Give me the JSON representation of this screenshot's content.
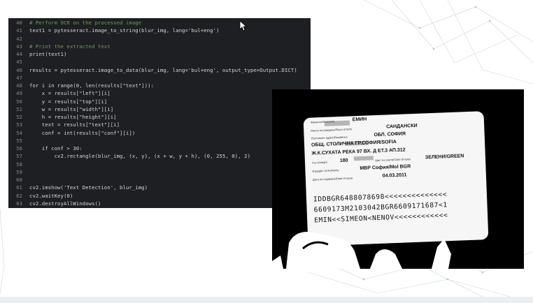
{
  "editor": {
    "lines": [
      {
        "num": "40",
        "code": "# Perform OCR on the processed image",
        "color": "#6a9955"
      },
      {
        "num": "41",
        "code": "text1 = pytesseract.image_to_string(blur_img, lang='bul+eng')",
        "color": "#d4d4d4"
      },
      {
        "num": "42",
        "code": "",
        "color": "#d4d4d4"
      },
      {
        "num": "43",
        "code": "# Print the extracted text",
        "color": "#6a9955"
      },
      {
        "num": "44",
        "code": "print(text1)",
        "color": "#d4d4d4"
      },
      {
        "num": "45",
        "code": "",
        "color": "#d4d4d4"
      },
      {
        "num": "46",
        "code": "results = pytesseract.image_to_data(blur_img, lang='bul+eng', output_type=Output.DICT)",
        "color": "#d4d4d4"
      },
      {
        "num": "47",
        "code": "",
        "color": "#d4d4d4"
      },
      {
        "num": "48",
        "code": "for i in range(0, len(results[\"text\"])):",
        "color": "#d4d4d4"
      },
      {
        "num": "49",
        "code": "    x = results[\"left\"][i]",
        "color": "#d4d4d4"
      },
      {
        "num": "50",
        "code": "    y = results[\"top\"][i]",
        "color": "#d4d4d4"
      },
      {
        "num": "51",
        "code": "    w = results[\"width\"][i]",
        "color": "#d4d4d4"
      },
      {
        "num": "52",
        "code": "    h = results[\"height\"][i]",
        "color": "#d4d4d4"
      },
      {
        "num": "53",
        "code": "    text = results[\"text\"][i]",
        "color": "#d4d4d4"
      },
      {
        "num": "54",
        "code": "    conf = int(results[\"conf\"][i])",
        "color": "#d4d4d4"
      },
      {
        "num": "55",
        "code": "",
        "color": "#d4d4d4"
      },
      {
        "num": "56",
        "code": "    if conf > 30:",
        "color": "#d4d4d4"
      },
      {
        "num": "57",
        "code": "        cv2.rectangle(blur_img, (x, y), (x + w, y + h), (0, 255, 0), 2)",
        "color": "#d4d4d4"
      },
      {
        "num": "58",
        "code": "",
        "color": "#d4d4d4"
      },
      {
        "num": "59",
        "code": "",
        "color": "#d4d4d4"
      },
      {
        "num": "60",
        "code": "",
        "color": "#d4d4d4"
      },
      {
        "num": "61",
        "code": "cv2.imshow('Text Detection', blur_img)",
        "color": "#d4d4d4"
      },
      {
        "num": "62",
        "code": "cv2.waitKey(0)",
        "color": "#d4d4d4"
      },
      {
        "num": "63",
        "code": "cv2.destroyAllWindows()",
        "color": "#d4d4d4"
      }
    ]
  },
  "card": {
    "fields": [
      {
        "label": "Фамилия/Surname",
        "value": "ЕМИН"
      },
      {
        "label": "Място на раждане/Place of birth",
        "value": "САНДАНСКИ"
      },
      {
        "label": "Постоянен адрес/Residence",
        "value": "ОБЛ. СОФИЯ"
      },
      {
        "label": "",
        "value": "ОБЩ. СТОЛИЧНА ГР.СОФИЯ/SOFIA"
      },
      {
        "label": "",
        "value": "Ж.К.СУХАТА РЕКА 97 ВХ. Д ЕТ.3 АП.312"
      },
      {
        "label": "Ръст/Height",
        "value": "180"
      },
      {
        "label": "Цвят на очите/Color of eyes",
        "value": "ЗЕЛЕНИ/GREEN"
      },
      {
        "label": "Издаден от/Authority",
        "value": "МВР София/Mol BGR"
      },
      {
        "label": "Дата на издаване/Date of issue",
        "value": "04.03.2011"
      }
    ],
    "mrz": [
      "IDDBGR6488078698<<<<<<<<<<<<<<",
      "6609173M2103042BGR6609171687<1",
      "EMIN<<SIMEON<NENOV<<<<<<<<<<<<"
    ]
  },
  "colors": {
    "editor_bg": "#1e1f22",
    "comment": "#6a9955",
    "code": "#d4d4d4",
    "line_number": "#858585"
  }
}
